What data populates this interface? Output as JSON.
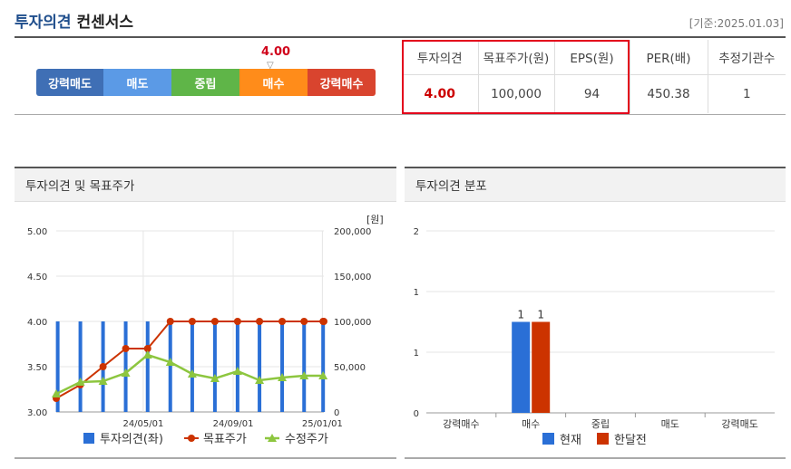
{
  "header": {
    "title_highlight": "투자의견",
    "title_rest": " 컨센서스",
    "date": "[기준:2025.01.03]"
  },
  "opinion_bar": {
    "current_value": "4.00",
    "segments": [
      {
        "label": "강력매도",
        "color": "#3f6fb5"
      },
      {
        "label": "매도",
        "color": "#5b9ae6"
      },
      {
        "label": "중립",
        "color": "#5fb548"
      },
      {
        "label": "매수",
        "color": "#ff8c1a"
      },
      {
        "label": "강력매수",
        "color": "#d9442e"
      }
    ]
  },
  "consensus_table": {
    "headers": [
      "투자의견",
      "목표주가(원)",
      "EPS(원)",
      "PER(배)",
      "추정기관수"
    ],
    "values": [
      "4.00",
      "100,000",
      "94",
      "450.38",
      "1"
    ]
  },
  "left_panel": {
    "title": "투자의견 및 목표주가",
    "unit_label": "[원]"
  },
  "right_panel": {
    "title": "투자의견 분포"
  },
  "colors": {
    "opinion_bar": "#2a6fd6",
    "target_price": "#cc3300",
    "adjusted_price": "#8dc63f",
    "current": "#2a6fd6",
    "month_ago": "#cc3300",
    "red_highlight": "#e3001b"
  },
  "chart_data": [
    {
      "type": "bar",
      "title": "투자의견 및 목표주가",
      "y_left_ticks": [
        "5.00",
        "4.50",
        "4.00",
        "3.50",
        "3.00"
      ],
      "y_left_range": [
        3.0,
        5.0
      ],
      "y_right_ticks": [
        "200,000",
        "150,000",
        "100,000",
        "50,000",
        "0"
      ],
      "y_right_range": [
        0,
        200000
      ],
      "x_tick_labels": [
        "24/05/01",
        "24/09/01",
        "25/01/01"
      ],
      "x_range": [
        "2024-01-03",
        "2025-01-03"
      ],
      "x_ticks": [
        "2024-05-01",
        "2024-09-01",
        "2025-01-01"
      ],
      "grid": true,
      "legend_position": "bottom",
      "series": [
        {
          "name": "투자의견(좌)",
          "type": "bar",
          "axis": "left",
          "x": [
            "2024-01-05",
            "2024-02-05",
            "2024-03-07",
            "2024-04-07",
            "2024-05-07",
            "2024-06-07",
            "2024-07-07",
            "2024-08-07",
            "2024-09-07",
            "2024-10-07",
            "2024-11-07",
            "2024-12-07",
            "2025-01-02"
          ],
          "values": [
            4,
            4,
            4,
            4,
            4,
            4,
            4,
            4,
            4,
            4,
            4,
            4,
            4
          ]
        },
        {
          "name": "목표주가",
          "type": "line",
          "axis": "right",
          "x": [
            "2024-01-03",
            "2024-02-05",
            "2024-03-07",
            "2024-04-07",
            "2024-05-07",
            "2024-06-07",
            "2024-07-07",
            "2024-08-07",
            "2024-09-07",
            "2024-10-07",
            "2024-11-07",
            "2024-12-07",
            "2025-01-02",
            "2025-01-03"
          ],
          "values": [
            15000,
            30000,
            50000,
            70000,
            70000,
            100000,
            100000,
            100000,
            100000,
            100000,
            100000,
            100000,
            100000,
            100000
          ]
        },
        {
          "name": "수정주가",
          "type": "line",
          "axis": "right",
          "x": [
            "2024-01-03",
            "2024-02-05",
            "2024-03-07",
            "2024-04-07",
            "2024-05-07",
            "2024-06-07",
            "2024-07-07",
            "2024-08-07",
            "2024-09-07",
            "2024-10-07",
            "2024-11-07",
            "2024-12-07",
            "2025-01-02"
          ],
          "values": [
            20000,
            33000,
            34000,
            43000,
            63000,
            55000,
            42000,
            37000,
            45000,
            35000,
            38000,
            40000,
            40000
          ]
        }
      ]
    },
    {
      "type": "bar",
      "title": "투자의견 분포",
      "categories": [
        "강력매수",
        "매수",
        "중립",
        "매도",
        "강력매도"
      ],
      "y_ticks": [
        "2",
        "1",
        "1",
        "0"
      ],
      "ylim": [
        0,
        2
      ],
      "grid": true,
      "legend_position": "bottom",
      "series": [
        {
          "name": "현재",
          "values": [
            0,
            1,
            0,
            0,
            0
          ]
        },
        {
          "name": "한달전",
          "values": [
            0,
            1,
            0,
            0,
            0
          ]
        }
      ]
    }
  ]
}
